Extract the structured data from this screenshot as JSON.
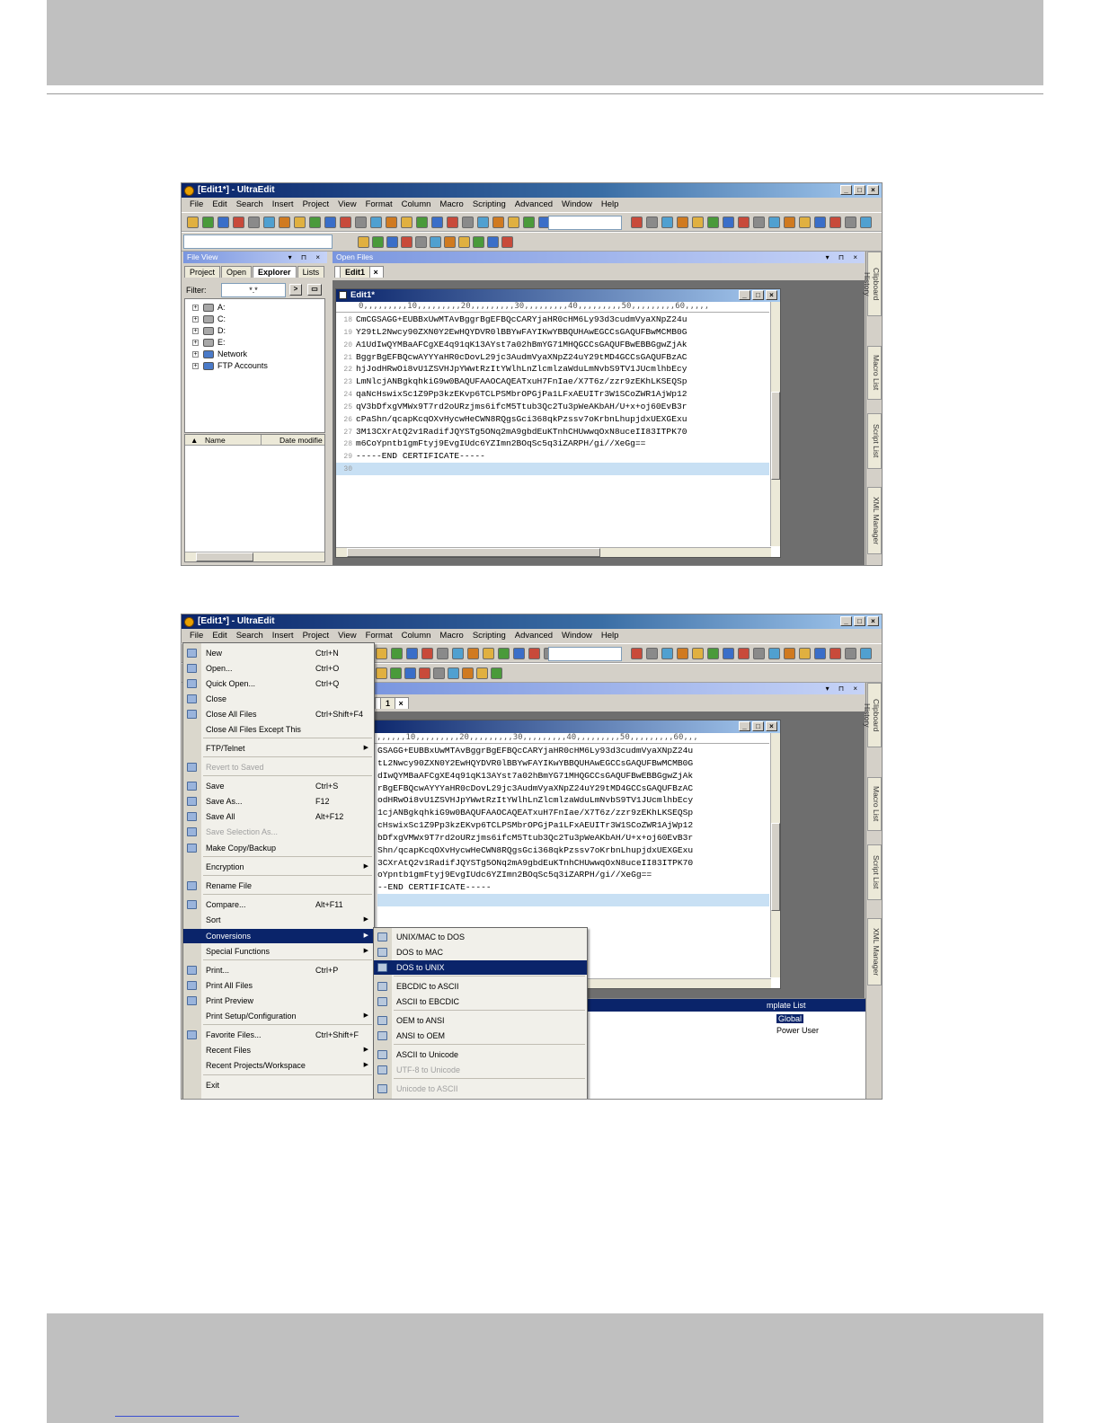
{
  "screenshot1": {
    "window_title": "[Edit1*] - UltraEdit",
    "menubar": [
      "File",
      "Edit",
      "Search",
      "Insert",
      "Project",
      "View",
      "Format",
      "Column",
      "Macro",
      "Scripting",
      "Advanced",
      "Window",
      "Help"
    ],
    "file_view": {
      "title": "File View",
      "tabs": [
        "Project",
        "Open",
        "Explorer",
        "Lists"
      ],
      "filter_label": "Filter:",
      "filter_value": "*.*",
      "tree": [
        "A:",
        "C:",
        "D:",
        "E:",
        "Network",
        "FTP Accounts"
      ],
      "columns": [
        "Name",
        "Date modifie"
      ]
    },
    "open_files": {
      "title": "Open Files",
      "tab": "Edit1"
    },
    "editor": {
      "title": "Edit1*",
      "ruler": "0,,,,,,,,,10,,,,,,,,,20,,,,,,,,,30,,,,,,,,,40,,,,,,,,,50,,,,,,,,,60,,,,,",
      "lines": [
        {
          "n": "18",
          "t": "CmCGSAGG+EUBBxUwMTAvBggrBgEFBQcCARYjaHR0cHM6Ly93d3cudmVyaXNpZ24u"
        },
        {
          "n": "19",
          "t": "Y29tL2Nwcy90ZXN0Y2EwHQYDVR0lBBYwFAYIKwYBBQUHAwEGCCsGAQUFBwMCMB0G"
        },
        {
          "n": "20",
          "t": "A1UdIwQYMBaAFCgXE4q91qK13AYst7a02hBmYG71MHQGCCsGAQUFBwEBBGgwZjAk"
        },
        {
          "n": "21",
          "t": "BggrBgEFBQcwAYYYaHR0cDovL29jc3AudmVyaXNpZ24uY29tMD4GCCsGAQUFBzAC"
        },
        {
          "n": "22",
          "t": "hjJodHRwOi8vU1ZSVHJpYWwtRzItYWlhLnZlcmlzaWduLmNvbS9TV1JUcmlhbEcy"
        },
        {
          "n": "23",
          "t": "LmNlcjANBgkqhkiG9w0BAQUFAAOCAQEATxuH7FnIae/X7T6z/zzr9zEKhLKSEQSp"
        },
        {
          "n": "24",
          "t": "qaNcHswixSc1Z9Pp3kzEKvp6TCLPSMbrOPGjPa1LFxAEUITr3W1SCoZWR1AjWp12"
        },
        {
          "n": "25",
          "t": "qV3bDfxgVMWx9T7rd2oURzjms6ifcM5Ttub3Qc2Tu3pWeAKbAH/U+x+oj60EvB3r"
        },
        {
          "n": "26",
          "t": "cPaShn/qcapKcqOXvHycwHeCWN8RQgsGci368qkPzssv7oKrbnLhupjdxUEXGExu"
        },
        {
          "n": "27",
          "t": "3M13CXrAtQ2v1RadifJQYSTg5ONq2mA9gbdEuKTnhCHUwwqOxN8uceII83ITPK70"
        },
        {
          "n": "28",
          "t": "m6CoYpntb1gmFtyj9EvgIUdc6YZImn2BOqSc5q3iZARPH/gi//XeGg=="
        },
        {
          "n": "29",
          "t": "-----END CERTIFICATE-----"
        },
        {
          "n": "30",
          "t": ""
        }
      ]
    },
    "side_tabs": [
      "Clipboard History",
      "Macro List",
      "Script List",
      "XML Manager"
    ]
  },
  "screenshot2": {
    "window_title": "[Edit1*] - UltraEdit",
    "menubar": [
      "File",
      "Edit",
      "Search",
      "Insert",
      "Project",
      "View",
      "Format",
      "Column",
      "Macro",
      "Scripting",
      "Advanced",
      "Window",
      "Help"
    ],
    "tab": "1",
    "ruler": ",,,,,,10,,,,,,,,,20,,,,,,,,,30,,,,,,,,,40,,,,,,,,,50,,,,,,,,,60,,,",
    "lines": [
      "GSAGG+EUBBxUwMTAvBggrBgEFBQcCARYjaHR0cHM6Ly93d3cudmVyaXNpZ24u",
      "tL2Nwcy90ZXN0Y2EwHQYDVR0lBBYwFAYIKwYBBQUHAwEGCCsGAQUFBwMCMB0G",
      "dIwQYMBaAFCgXE4q91qK13AYst7a02hBmYG71MHQGCCsGAQUFBwEBBGgwZjAk",
      "rBgEFBQcwAYYYaHR0cDovL29jc3AudmVyaXNpZ24uY29tMD4GCCsGAQUFBzAC",
      "odHRwOi8vU1ZSVHJpYWwtRzItYWlhLnZlcmlzaWduLmNvbS9TV1JUcmlhbEcy",
      "1cjANBgkqhkiG9w0BAQUFAAOCAQEATxuH7FnIae/X7T6z/zzr9zEKhLKSEQSp",
      "cHswixSc1Z9Pp3kzEKvp6TCLPSMbrOPGjPa1LFxAEUITr3W1SCoZWR1AjWp12",
      "bDfxgVMWx9T7rd2oURzjms6ifcM5Ttub3Qc2Tu3pWeAKbAH/U+x+oj60EvB3r",
      "Shn/qcapKcqOXvHycwHeCWN8RQgsGci368qkPzssv7oKrbnLhupjdxUEXGExu",
      "3CXrAtQ2v1RadifJQYSTg5ONq2mA9gbdEuKTnhCHUwwqOxN8uceII83ITPK70",
      "oYpntb1gmFtyj9EvgIUdc6YZImn2BOqSc5q3iZARPH/gi//XeGg==",
      "--END CERTIFICATE-----",
      ""
    ],
    "file_menu": [
      {
        "label": "New",
        "shortcut": "Ctrl+N"
      },
      {
        "label": "Open...",
        "shortcut": "Ctrl+O"
      },
      {
        "label": "Quick Open...",
        "shortcut": "Ctrl+Q"
      },
      {
        "label": "Close",
        "shortcut": ""
      },
      {
        "label": "Close All Files",
        "shortcut": "Ctrl+Shift+F4"
      },
      {
        "label": "Close All Files Except This",
        "shortcut": ""
      },
      {
        "label": "FTP/Telnet",
        "shortcut": ""
      },
      {
        "label": "Revert to Saved",
        "shortcut": ""
      },
      {
        "label": "Save",
        "shortcut": "Ctrl+S"
      },
      {
        "label": "Save As...",
        "shortcut": "F12"
      },
      {
        "label": "Save All",
        "shortcut": "Alt+F12"
      },
      {
        "label": "Save Selection As...",
        "shortcut": ""
      },
      {
        "label": "Make Copy/Backup",
        "shortcut": ""
      },
      {
        "label": "Encryption",
        "shortcut": ""
      },
      {
        "label": "Rename File",
        "shortcut": ""
      },
      {
        "label": "Compare...",
        "shortcut": "Alt+F11"
      },
      {
        "label": "Sort",
        "shortcut": ""
      },
      {
        "label": "Conversions",
        "shortcut": ""
      },
      {
        "label": "Special Functions",
        "shortcut": ""
      },
      {
        "label": "Print...",
        "shortcut": "Ctrl+P"
      },
      {
        "label": "Print All Files",
        "shortcut": ""
      },
      {
        "label": "Print Preview",
        "shortcut": ""
      },
      {
        "label": "Print Setup/Configuration",
        "shortcut": ""
      },
      {
        "label": "Favorite Files...",
        "shortcut": "Ctrl+Shift+F"
      },
      {
        "label": "Recent Files",
        "shortcut": ""
      },
      {
        "label": "Recent Projects/Workspace",
        "shortcut": ""
      },
      {
        "label": "Exit",
        "shortcut": ""
      }
    ],
    "conversions_menu": [
      "UNIX/MAC to DOS",
      "DOS to MAC",
      "DOS to UNIX",
      "EBCDIC to ASCII",
      "ASCII to EBCDIC",
      "OEM to ANSI",
      "ANSI to OEM",
      "ASCII to Unicode",
      "UTF-8 to Unicode",
      "Unicode to ASCII"
    ],
    "template_list": {
      "title": "mplate List",
      "items": [
        "Global",
        "Power User"
      ]
    },
    "side_tabs": [
      "Clipboard History",
      "Macro List",
      "Script List",
      "XML Manager"
    ]
  }
}
